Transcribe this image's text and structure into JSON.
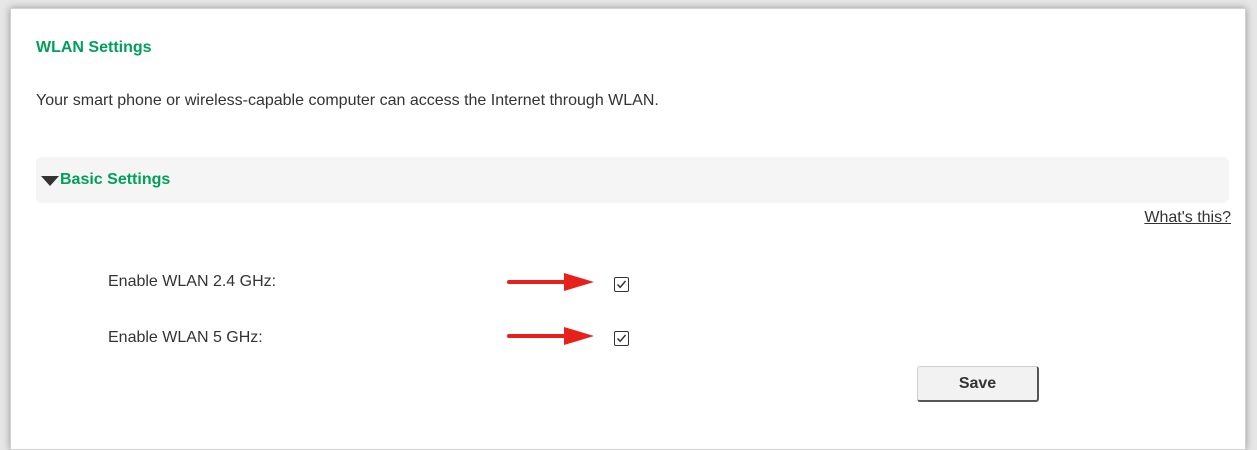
{
  "page": {
    "title": "WLAN Settings",
    "description": "Your smart phone or wireless-capable computer can access the Internet through WLAN."
  },
  "basic_settings": {
    "title": "Basic Settings",
    "expanded": true,
    "caret_icon": "caret-down-icon",
    "help_link": "What's this?"
  },
  "options": [
    {
      "label": "Enable WLAN 2.4 GHz:",
      "checked": true
    },
    {
      "label": "Enable WLAN 5 GHz:",
      "checked": true
    }
  ],
  "annotations": {
    "arrow_icon": "red-arrow-right-icon",
    "arrow_color": "#e8201c"
  },
  "actions": {
    "save_label": "Save"
  },
  "colors": {
    "accent": "#00a05a",
    "text": "#333333",
    "section_background": "#f5f5f5"
  }
}
